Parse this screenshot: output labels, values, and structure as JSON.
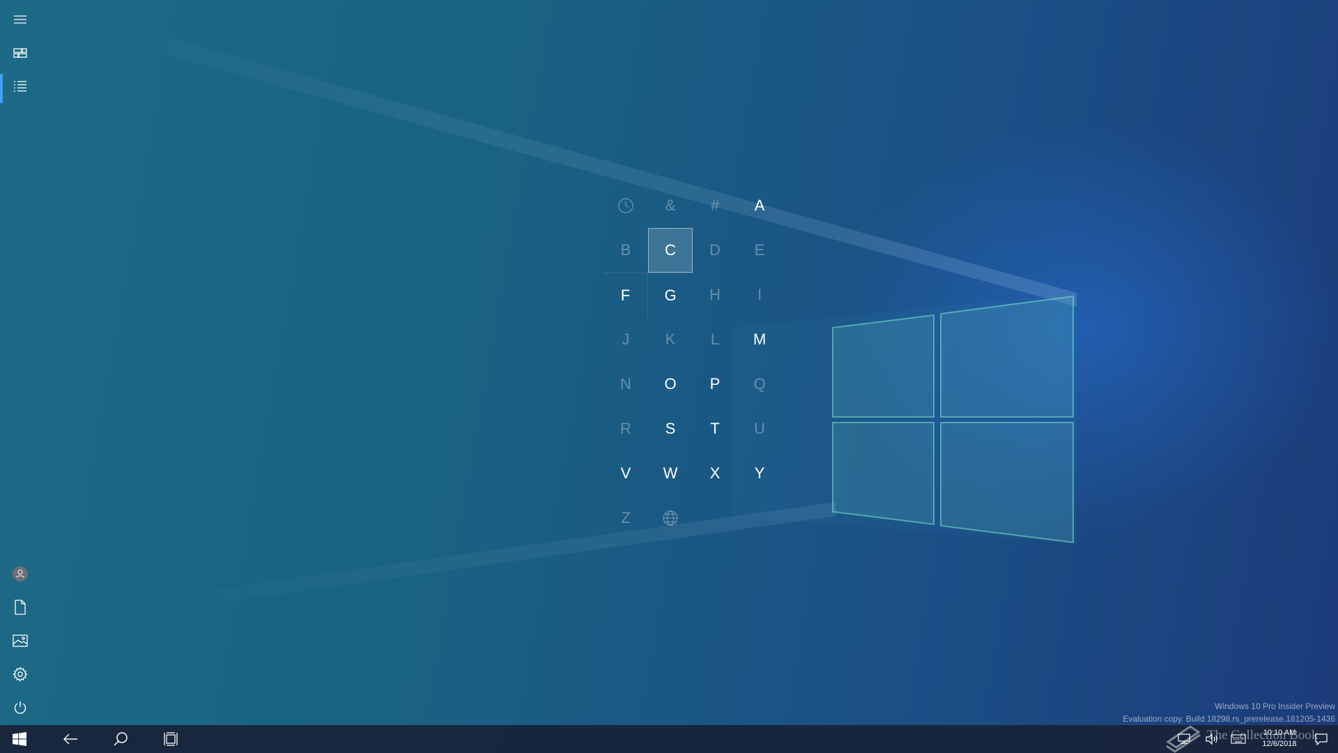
{
  "rail": {
    "top": [
      {
        "name": "hamburger-menu-icon",
        "label": "Expand"
      },
      {
        "name": "tiles-icon",
        "label": "Pinned tiles"
      },
      {
        "name": "all-apps-list-icon",
        "label": "All apps",
        "active": true
      }
    ],
    "bottom": [
      {
        "name": "user-account-icon",
        "label": "Account"
      },
      {
        "name": "documents-icon",
        "label": "Documents"
      },
      {
        "name": "pictures-icon",
        "label": "Pictures"
      },
      {
        "name": "settings-icon",
        "label": "Settings"
      },
      {
        "name": "power-icon",
        "label": "Power"
      }
    ]
  },
  "jump_list": {
    "cells": [
      {
        "label": "",
        "icon": "clock-icon",
        "enabled": false
      },
      {
        "label": "&",
        "enabled": false
      },
      {
        "label": "#",
        "enabled": false
      },
      {
        "label": "A",
        "enabled": true
      },
      {
        "label": "B",
        "enabled": false
      },
      {
        "label": "C",
        "enabled": true,
        "selected": true
      },
      {
        "label": "D",
        "enabled": false
      },
      {
        "label": "E",
        "enabled": false
      },
      {
        "label": "F",
        "enabled": true
      },
      {
        "label": "G",
        "enabled": true
      },
      {
        "label": "H",
        "enabled": false
      },
      {
        "label": "I",
        "enabled": false
      },
      {
        "label": "J",
        "enabled": false
      },
      {
        "label": "K",
        "enabled": false
      },
      {
        "label": "L",
        "enabled": false
      },
      {
        "label": "M",
        "enabled": true
      },
      {
        "label": "N",
        "enabled": false
      },
      {
        "label": "O",
        "enabled": true
      },
      {
        "label": "P",
        "enabled": true
      },
      {
        "label": "Q",
        "enabled": false
      },
      {
        "label": "R",
        "enabled": false
      },
      {
        "label": "S",
        "enabled": true
      },
      {
        "label": "T",
        "enabled": true
      },
      {
        "label": "U",
        "enabled": false
      },
      {
        "label": "V",
        "enabled": true
      },
      {
        "label": "W",
        "enabled": true
      },
      {
        "label": "X",
        "enabled": true
      },
      {
        "label": "Y",
        "enabled": true
      },
      {
        "label": "Z",
        "enabled": false
      },
      {
        "label": "",
        "icon": "globe-icon",
        "enabled": false
      }
    ]
  },
  "taskbar": {
    "start": "start-button",
    "back": "back-button",
    "search": "search-button",
    "task_view": "task-view-button",
    "tray": {
      "time": "10:10 AM",
      "date": "12/6/2018"
    }
  },
  "watermark": {
    "line1": "Windows 10 Pro Insider Preview",
    "line2": "Evaluation copy. Build 18298.rs_prerelease.181205-1436"
  },
  "brand": {
    "text": "The Collection Book"
  },
  "colors": {
    "accent": "#3ea0ff",
    "taskbar": "#18243a"
  }
}
